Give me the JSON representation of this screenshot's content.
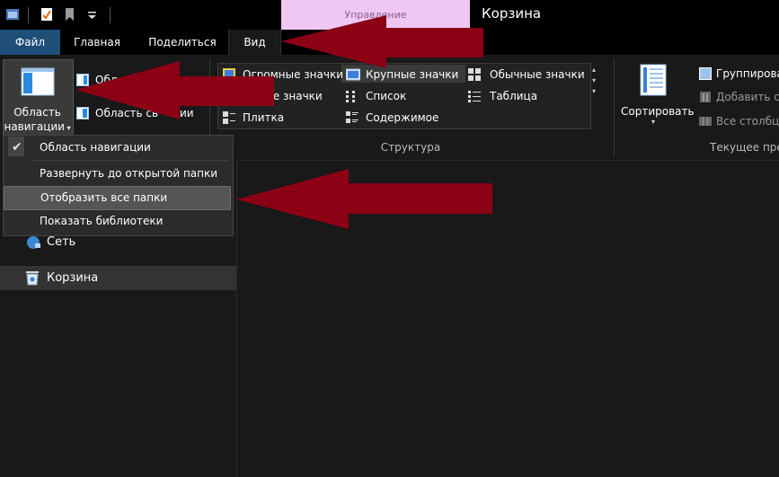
{
  "window": {
    "title": "Корзина",
    "contextual_tab": "Управление"
  },
  "quick_access": {
    "icons": [
      "explorer-icon",
      "properties-check-icon",
      "new-folder-icon",
      "customize-dropdown-icon"
    ]
  },
  "ribbon_tabs": [
    {
      "label": "Файл"
    },
    {
      "label": "Главная"
    },
    {
      "label": "Поделиться"
    },
    {
      "label": "Вид"
    }
  ],
  "panes_group": {
    "nav_pane_label_line1": "Область",
    "nav_pane_label_line2": "навигации",
    "preview_pane_partial": "Обл",
    "details_pane_partial": "Область св",
    "details_pane_suffix": "ии"
  },
  "layout_group": {
    "items": [
      {
        "label": "Огромные значки"
      },
      {
        "label": "Крупные значки"
      },
      {
        "label": "Обычные значки"
      },
      {
        "label": "ие значки"
      },
      {
        "label": "Список"
      },
      {
        "label": "Таблица"
      },
      {
        "label": "Плитка"
      },
      {
        "label": "Содержимое"
      }
    ],
    "group_label": "Структура"
  },
  "current_view_group": {
    "sort_label": "Сортировать",
    "group_by": "Группирова",
    "add_columns": "Добавить с",
    "all_columns": "Все столбц",
    "group_label": "Текущее пре"
  },
  "dropdown": {
    "items": [
      {
        "label": "Область навигации",
        "checked": true
      },
      {
        "label": "Развернуть до открытой папки",
        "checked": false
      },
      {
        "label": "Отобразить все папки",
        "checked": false,
        "highlighted": true
      },
      {
        "label": "Показать библиотеки",
        "checked": false
      }
    ]
  },
  "nav_tree": [
    {
      "label": "Сеть",
      "icon": "network-icon"
    },
    {
      "label": "Корзина",
      "icon": "recycle-bin-icon",
      "selected": true
    }
  ],
  "colors": {
    "background": "#191919",
    "accent_file_tab": "#1f4e79",
    "contextual_tab": "#f0c6f3",
    "arrow": "#8b0015"
  }
}
